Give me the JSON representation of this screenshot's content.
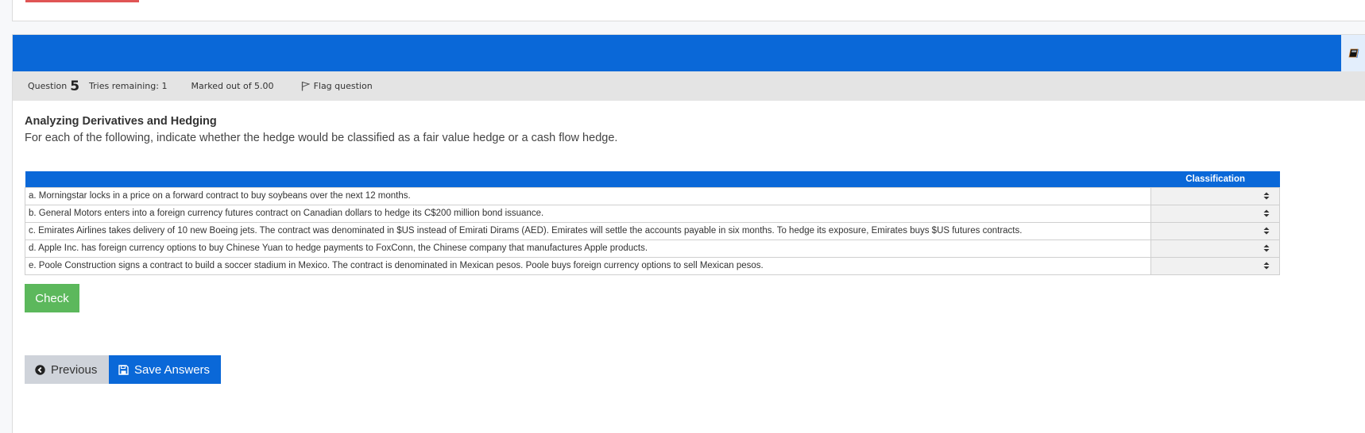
{
  "colors": {
    "header_blue": "#0a68d8",
    "check_green": "#5cb85c",
    "previous_gray": "#cfd3da",
    "info_bar_gray": "#e4e4e4",
    "accent_red": "#e05555"
  },
  "question": {
    "label": "Question",
    "number": "5",
    "tries_remaining": "Tries remaining: 1",
    "marked_out_of": "Marked out of 5.00",
    "flag_label": "Flag question",
    "title": "Analyzing Derivatives and Hedging",
    "description": "For each of the following, indicate whether the hedge would be classified as a fair value hedge or a cash flow hedge."
  },
  "table": {
    "headers": [
      "",
      "Classification"
    ],
    "rows": [
      {
        "statement": "a. Morningstar locks in a price on a forward contract to buy soybeans over the next 12 months.",
        "classification": ""
      },
      {
        "statement": "b. General Motors enters into a foreign currency futures contract on Canadian dollars to hedge its C$200 million bond issuance.",
        "classification": ""
      },
      {
        "statement": "c. Emirates Airlines takes delivery of 10 new Boeing jets. The contract was denominated in $US instead of Emirati Dirams (AED). Emirates will settle the accounts payable in six months. To hedge its exposure, Emirates buys $US futures contracts.",
        "classification": ""
      },
      {
        "statement": "d. Apple Inc. has foreign currency options to buy Chinese Yuan to hedge payments to FoxConn, the Chinese company that manufactures Apple products.",
        "classification": ""
      },
      {
        "statement": "e. Poole Construction signs a contract to build a soccer stadium in Mexico. The contract is denominated in Mexican pesos. Poole buys foreign currency options to sell Mexican pesos.",
        "classification": ""
      }
    ]
  },
  "buttons": {
    "check": "Check",
    "previous": "Previous",
    "save": "Save Answers"
  },
  "icons": {
    "header_side": "book-icon",
    "flag": "flag-icon",
    "select": "sort-arrows-icon",
    "previous": "chevron-circle-left-icon",
    "save": "floppy-disk-icon"
  }
}
